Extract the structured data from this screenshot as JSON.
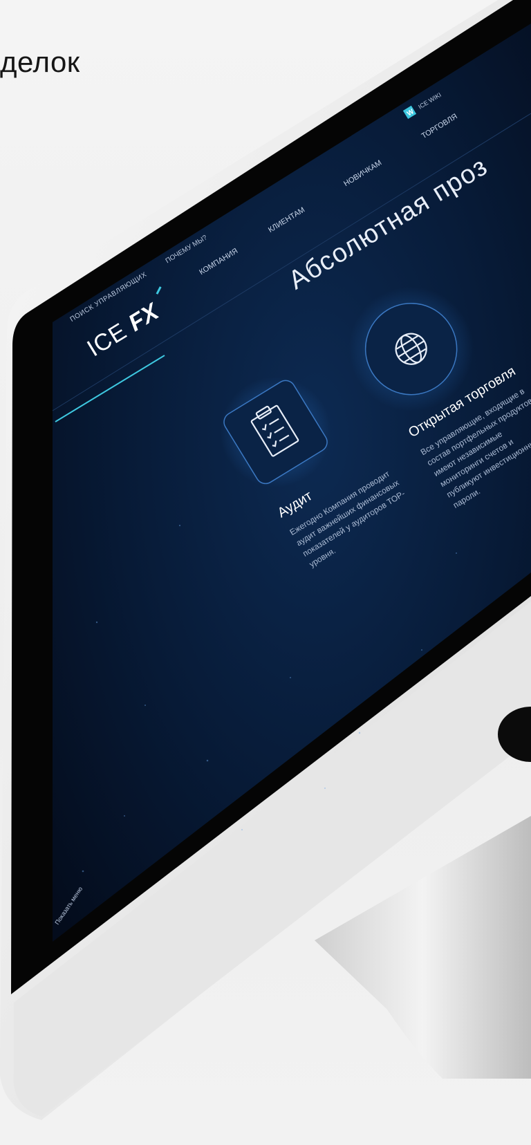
{
  "page": {
    "heading": "делок"
  },
  "site": {
    "logo": {
      "ice": "ICE",
      "fx": "FX"
    },
    "top_link": "ПОИСК УПРАВЛЯЮЩИХ",
    "nav": [
      "ПОЧЕМУ МЫ?",
      "КОМПАНИЯ",
      "КЛИЕНТАМ",
      "НОВИЧКАМ",
      "ТОРГОВЛЯ"
    ],
    "wiki": {
      "icon": "wikipedia-icon",
      "label": "ICE WIKI"
    },
    "hero_title": "Абсолютная проз",
    "features": [
      {
        "icon": "clipboard-icon",
        "title": "Аудит",
        "lines": [
          "Ежегодно Компания проводит",
          "аудит важнейших финансовых",
          "показателей у аудиторов ТОР-",
          "уровня."
        ]
      },
      {
        "icon": "globe-icon",
        "title": "Открытая торговля",
        "lines": [
          "Все управляющие, входящие в",
          "состав портфельных продуктов,",
          "имеют независимые",
          "мониторинги счетов и",
          "публикуют инвестиционные",
          "пароли."
        ]
      }
    ],
    "show_menu": "Показать меню"
  },
  "colors": {
    "screen_bg": "#07162e",
    "accent": "#3ec8e0",
    "text": "#dbe6f5",
    "bezel": "#050505",
    "frame": "#e9e9e9"
  }
}
